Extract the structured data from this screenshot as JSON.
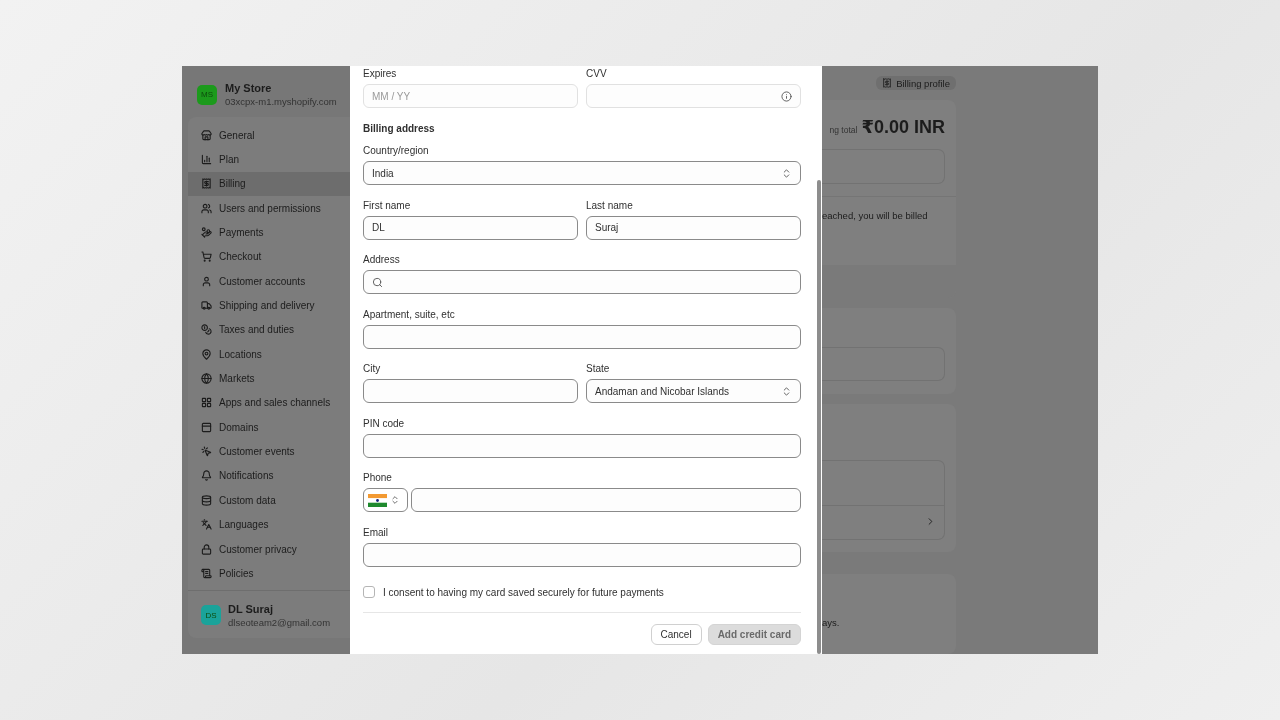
{
  "store": {
    "initials": "MS",
    "name": "My Store",
    "domain": "03xcpx-m1.myshopify.com"
  },
  "nav": [
    {
      "label": "General",
      "selected": false
    },
    {
      "label": "Plan",
      "selected": false
    },
    {
      "label": "Billing",
      "selected": true
    },
    {
      "label": "Users and permissions",
      "selected": false
    },
    {
      "label": "Payments",
      "selected": false
    },
    {
      "label": "Checkout",
      "selected": false
    },
    {
      "label": "Customer accounts",
      "selected": false
    },
    {
      "label": "Shipping and delivery",
      "selected": false
    },
    {
      "label": "Taxes and duties",
      "selected": false
    },
    {
      "label": "Locations",
      "selected": false
    },
    {
      "label": "Markets",
      "selected": false
    },
    {
      "label": "Apps and sales channels",
      "selected": false
    },
    {
      "label": "Domains",
      "selected": false
    },
    {
      "label": "Customer events",
      "selected": false
    },
    {
      "label": "Notifications",
      "selected": false
    },
    {
      "label": "Custom data",
      "selected": false
    },
    {
      "label": "Languages",
      "selected": false
    },
    {
      "label": "Customer privacy",
      "selected": false
    },
    {
      "label": "Policies",
      "selected": false
    }
  ],
  "user": {
    "initials": "DS",
    "name": "DL Suraj",
    "email": "dlseoteam2@gmail.com"
  },
  "page": {
    "billing_profile_button": "Billing profile",
    "total_label": "ng total",
    "total": "₹0.00 INR",
    "notice": "eached, you will be billed",
    "footer_text": "ays."
  },
  "modal": {
    "rows": [
      [
        {
          "label": "Expires",
          "kind": "text",
          "placeholder": "MM / YY"
        },
        {
          "label": "CVV",
          "kind": "info"
        }
      ],
      [
        {
          "label": "Billing address",
          "kind": "heading"
        }
      ],
      [
        {
          "label": "Country/region",
          "kind": "select",
          "value": "India"
        }
      ],
      [
        {
          "label": "First name",
          "kind": "text",
          "value": "DL"
        },
        {
          "label": "Last name",
          "kind": "text",
          "value": "Suraj"
        }
      ],
      [
        {
          "label": "Address",
          "kind": "search"
        }
      ],
      [
        {
          "label": "Apartment, suite, etc",
          "kind": "text"
        }
      ],
      [
        {
          "label": "City",
          "kind": "text"
        },
        {
          "label": "State",
          "kind": "select",
          "value": "Andaman and Nicobar Islands"
        }
      ],
      [
        {
          "label": "PIN code",
          "kind": "text"
        }
      ],
      [
        {
          "label": "Phone",
          "kind": "phone"
        }
      ],
      [
        {
          "label": "Email",
          "kind": "text"
        }
      ]
    ],
    "consent": {
      "label": "I consent to having my card saved securely for future payments",
      "checked": false
    },
    "cancel": {
      "label": "Cancel"
    },
    "submit": {
      "label": "Add credit card",
      "disabled": true
    }
  }
}
